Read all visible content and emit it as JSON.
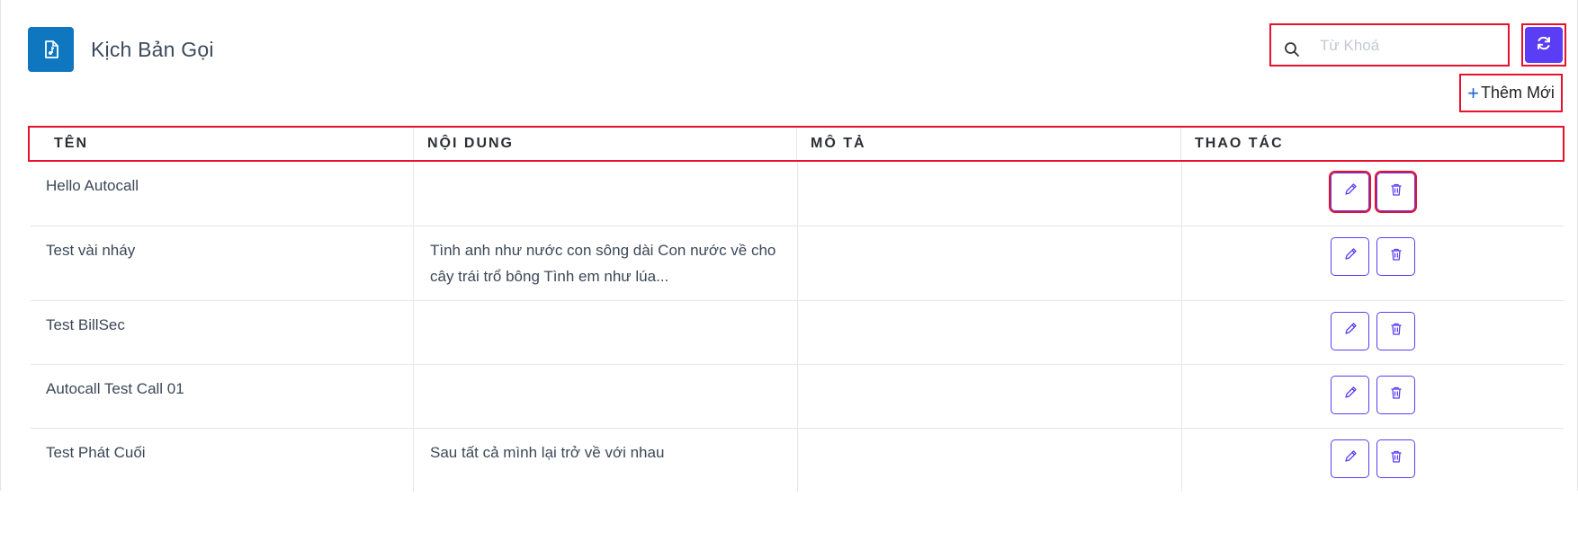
{
  "header": {
    "title": "Kịch Bản Gọi",
    "icon": "music-file-icon"
  },
  "search": {
    "placeholder": "Từ Khoá",
    "value": ""
  },
  "toolbar": {
    "refresh_icon": "refresh-icon",
    "add_label": "Thêm Mới",
    "add_icon": "+"
  },
  "table": {
    "columns": [
      "TÊN",
      "NỘI DUNG",
      "MÔ TẢ",
      "THAO TÁC"
    ],
    "rows": [
      {
        "name": "Hello Autocall",
        "content": "",
        "description": ""
      },
      {
        "name": "Test vài nháy",
        "content": "Tình anh như nước con sông dài Con nước về cho cây trái trổ bông Tình em như lúa...",
        "description": ""
      },
      {
        "name": "Test BillSec",
        "content": "",
        "description": ""
      },
      {
        "name": "Autocall Test Call 01",
        "content": "",
        "description": ""
      },
      {
        "name": "Test Phát Cuối",
        "content": "Sau tất cả mình lại trở về với nhau",
        "description": ""
      }
    ]
  },
  "colors": {
    "accent": "#5b3df5",
    "title_icon_bg": "#0f76c0",
    "highlight": "#e8102a"
  }
}
